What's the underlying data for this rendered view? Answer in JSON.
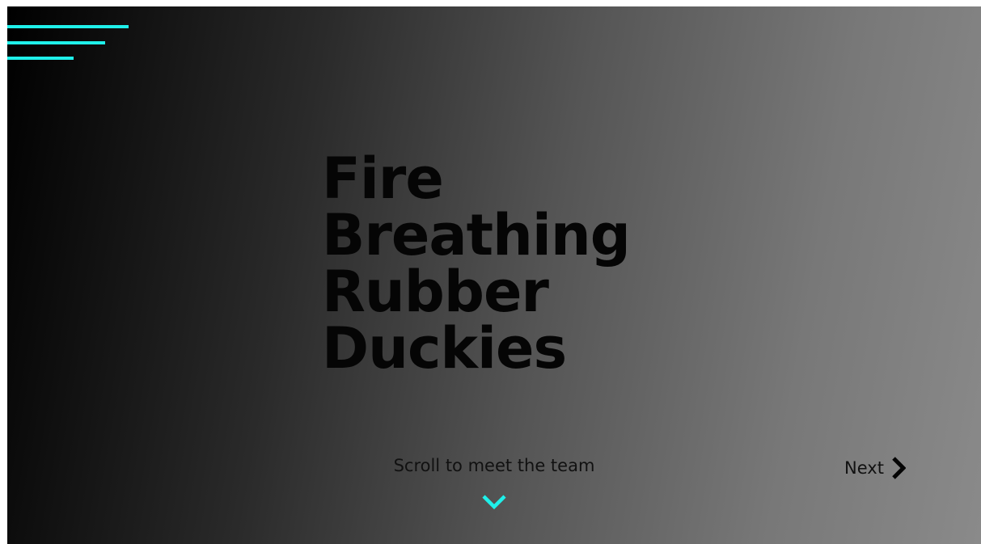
{
  "hero": {
    "title_lines": [
      "Fire",
      "Breathing",
      "Rubber",
      "Duckies"
    ],
    "scroll_hint": "Scroll to meet the team",
    "next_label": "Next"
  },
  "icons": {
    "menu": "hamburger-menu-icon",
    "scroll": "chevron-down-icon",
    "next": "chevron-right-icon"
  },
  "colors": {
    "accent": "#1ff0ea",
    "title": "#050505",
    "gradient_start": "#000000",
    "gradient_end": "#8a8a8a"
  }
}
